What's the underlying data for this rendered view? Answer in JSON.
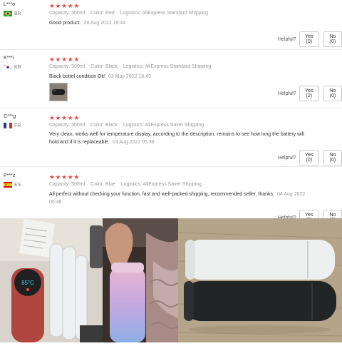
{
  "labels": {
    "capacity": "Capacity:",
    "color": "Color:",
    "logistics": "Logistics:",
    "helpful": "Helpful?"
  },
  "reviews": [
    {
      "user": "L***o",
      "country": "BR",
      "stars": "★★★★★",
      "capacity": "500ml",
      "color": "Red",
      "logistics": "AliExpress Standard Shipping",
      "text": "Good product.",
      "date": "29 Aug 2022 19:44",
      "yes": "Yes (0)",
      "no": "No (0)"
    },
    {
      "user": "K***i",
      "country": "KR",
      "stars": "★★★★★",
      "capacity": "500ml",
      "color": "Black",
      "logistics": "AliExpress Standard Shipping",
      "text": "Black bottel condition Ok!",
      "date": "03 May 2022 18:49",
      "yes": "Yes (2)",
      "no": "No (0)"
    },
    {
      "user": "C***g",
      "country": "FR",
      "stars": "★★★★★",
      "capacity": "500ml",
      "color": "Black",
      "logistics": "AliExpress Saver Shipping",
      "text": "Very clean, works well for temperature display, according to the description, remains to see how long the battery will hold and if it is replaceable.",
      "date": "03 Aug 2022 05:38",
      "yes": "Yes (0)",
      "no": "No (0)"
    },
    {
      "user": "P***z",
      "country": "ES",
      "stars": "★★★★★",
      "capacity": "500ml",
      "color": "Blue",
      "logistics": "AliExpress Saver Shipping",
      "text": "All perfect without checking your function, fast and well-packed shipping, recommended seller, thanks.",
      "date": "04 Aug 2022 05:48",
      "yes": "Yes (0)",
      "no": "No (0)"
    }
  ],
  "photos": {
    "bottle_display": "85°C"
  },
  "colors": {
    "star": "#f03c3c",
    "muted_text": "#999999",
    "divider": "#e8e8e8"
  }
}
